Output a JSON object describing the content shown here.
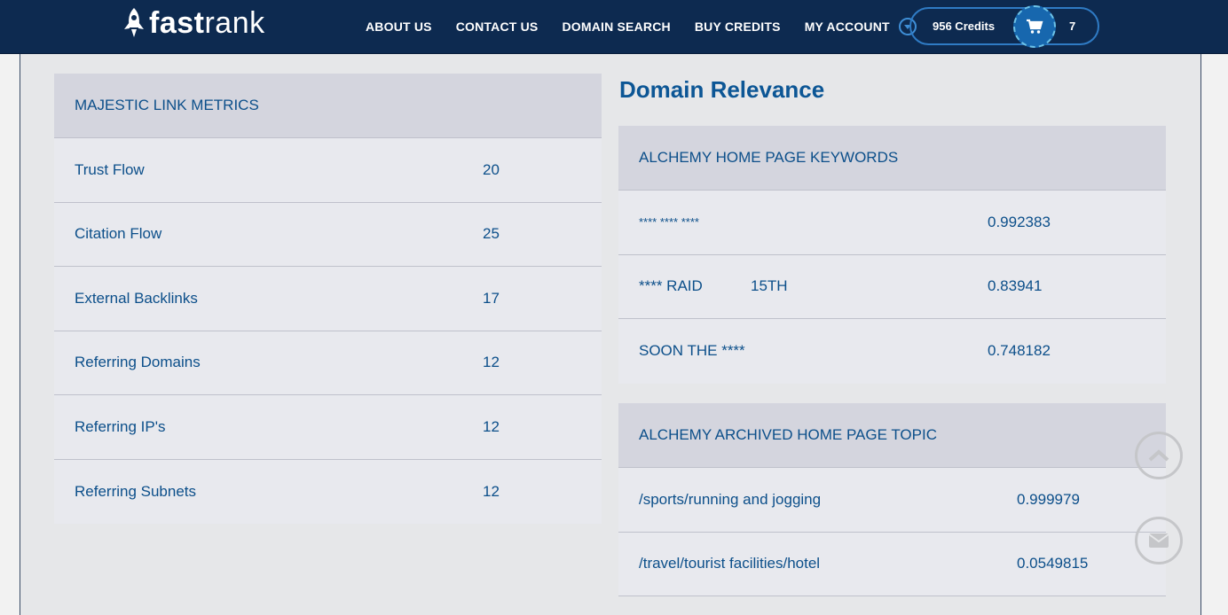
{
  "header": {
    "logo_fast": "fast",
    "logo_rank": "rank",
    "nav": [
      "ABOUT US",
      "CONTACT US",
      "DOMAIN SEARCH",
      "BUY CREDITS",
      "MY ACCOUNT"
    ],
    "credits": "956 Credits",
    "cart_count": "7"
  },
  "majestic": {
    "title": "MAJESTIC LINK METRICS",
    "rows": [
      {
        "label": "Trust Flow",
        "value": "20"
      },
      {
        "label": "Citation Flow",
        "value": "25"
      },
      {
        "label": "External Backlinks",
        "value": "17"
      },
      {
        "label": "Referring Domains",
        "value": "12"
      },
      {
        "label": "Referring IP's",
        "value": "12"
      },
      {
        "label": "Referring Subnets",
        "value": "12"
      }
    ]
  },
  "relevance": {
    "title": "Domain Relevance",
    "keywords": {
      "title": "ALCHEMY HOME PAGE KEYWORDS",
      "rows": [
        {
          "label": "**** **** ****",
          "extra": "",
          "value": "0.992383"
        },
        {
          "label": "**** RAID",
          "extra": "15TH",
          "value": "0.83941"
        },
        {
          "label": "SOON THE ****",
          "extra": "",
          "value": "0.748182"
        }
      ]
    },
    "topics": {
      "title": "ALCHEMY ARCHIVED HOME PAGE TOPIC",
      "rows": [
        {
          "label": "/sports/running and jogging",
          "value": "0.999979"
        },
        {
          "label": "/travel/tourist facilities/hotel",
          "value": "0.0549815"
        }
      ]
    }
  },
  "icons": {
    "logo": "rocket-icon",
    "account": "chevron-down-icon",
    "cart": "shopping-cart-icon",
    "scroll_top": "chevron-up-icon",
    "contact": "envelope-icon"
  },
  "colors": {
    "header_bg": "#0d2a50",
    "accent": "#0c5695",
    "text": "#0c4f8a"
  }
}
